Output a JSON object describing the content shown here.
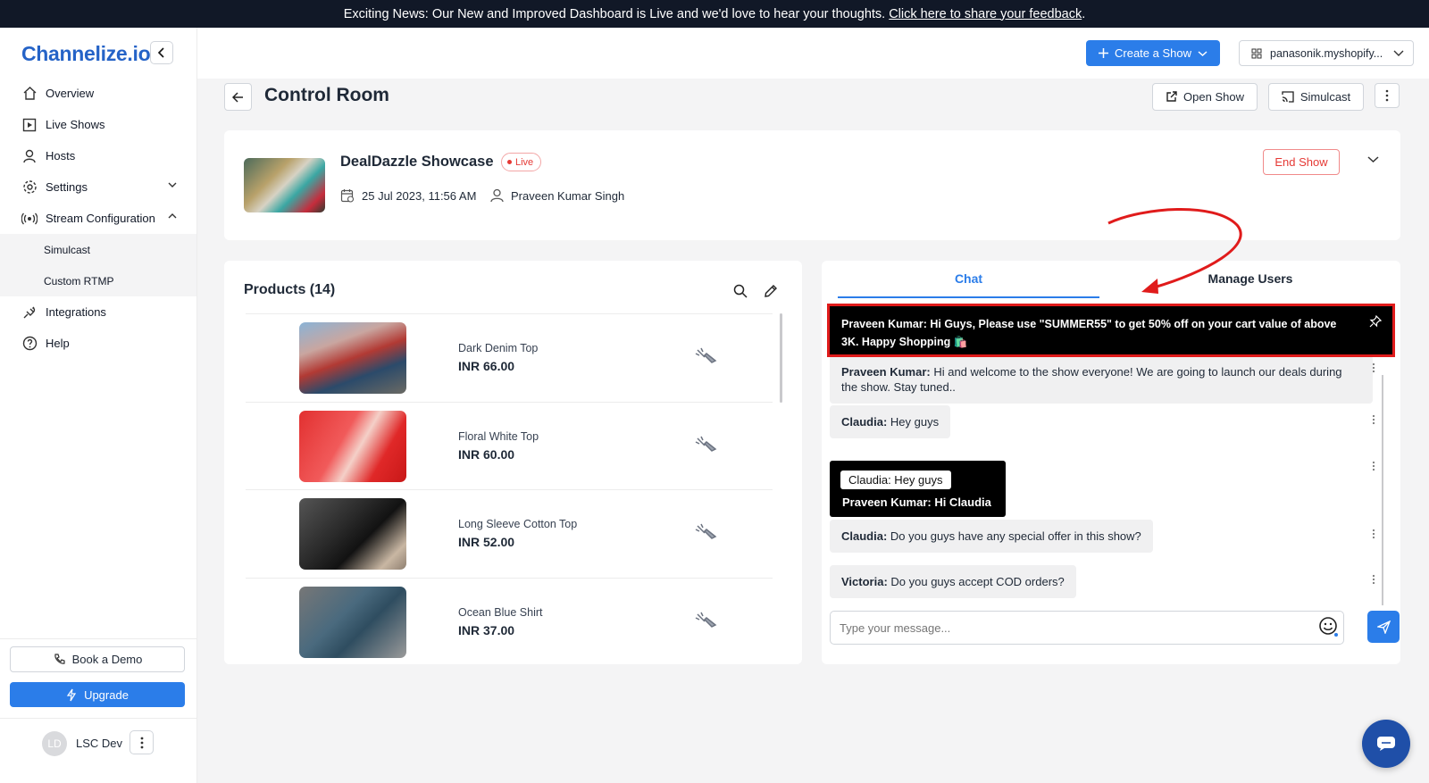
{
  "announcement": {
    "text": "Exciting News: Our New and Improved Dashboard is Live and we'd love to hear your thoughts.",
    "link": "Click here to share your feedback",
    "suffix": "."
  },
  "sidebar": {
    "logo": "Channelize.io",
    "items": [
      {
        "label": "Overview",
        "icon": "home-icon"
      },
      {
        "label": "Live Shows",
        "icon": "play-square-icon"
      },
      {
        "label": "Hosts",
        "icon": "users-icon"
      },
      {
        "label": "Settings",
        "icon": "gear-icon"
      },
      {
        "label": "Stream Configuration",
        "icon": "broadcast-icon"
      },
      {
        "label": "Integrations",
        "icon": "plug-icon"
      },
      {
        "label": "Help",
        "icon": "help-icon"
      }
    ],
    "sub_items": [
      "Simulcast",
      "Custom RTMP"
    ],
    "book_demo": "Book a Demo",
    "upgrade": "Upgrade",
    "user": {
      "initials": "LD",
      "name": "LSC Dev"
    }
  },
  "topbar": {
    "create_show": "Create a Show",
    "store": "panasonik.myshopify..."
  },
  "control_room": {
    "title": "Control Room",
    "open_show": "Open Show",
    "simulcast": "Simulcast"
  },
  "show": {
    "name": "DealDazzle Showcase",
    "status": "Live",
    "date": "25 Jul 2023, 11:56 AM",
    "host": "Praveen Kumar Singh",
    "end_show": "End Show"
  },
  "products": {
    "title": "Products (14)",
    "items": [
      {
        "name": "Dark Denim Top",
        "price": "INR 66.00"
      },
      {
        "name": "Floral White Top",
        "price": "INR 60.00"
      },
      {
        "name": "Long Sleeve Cotton Top",
        "price": "INR 52.00"
      },
      {
        "name": "Ocean Blue Shirt",
        "price": "INR 37.00"
      }
    ]
  },
  "chat": {
    "tabs": [
      "Chat",
      "Manage Users"
    ],
    "pinned": {
      "author": "Praveen Kumar:",
      "text": " Hi Guys, Please use \"SUMMER55\" to get 50% off on your cart value of above 3K. Happy Shopping 🛍️"
    },
    "messages": [
      {
        "author": "Praveen Kumar:",
        "text": " Hi and welcome to the show everyone! We are going to launch our deals during the show. Stay tuned.."
      },
      {
        "author": "Claudia:",
        "text": " Hey guys"
      },
      {
        "author": "Claudia:",
        "text": " Do you guys have any special offer in this show?"
      },
      {
        "author": "Victoria:",
        "text": " Do you guys accept COD orders?"
      }
    ],
    "reply": {
      "quote": "Claudia: Hey guys",
      "body": "Praveen Kumar: Hi Claudia"
    },
    "input_placeholder": "Type your message..."
  },
  "colors": {
    "accent": "#2b7de9",
    "danger": "#e53935",
    "annotation": "#e01b1b"
  }
}
